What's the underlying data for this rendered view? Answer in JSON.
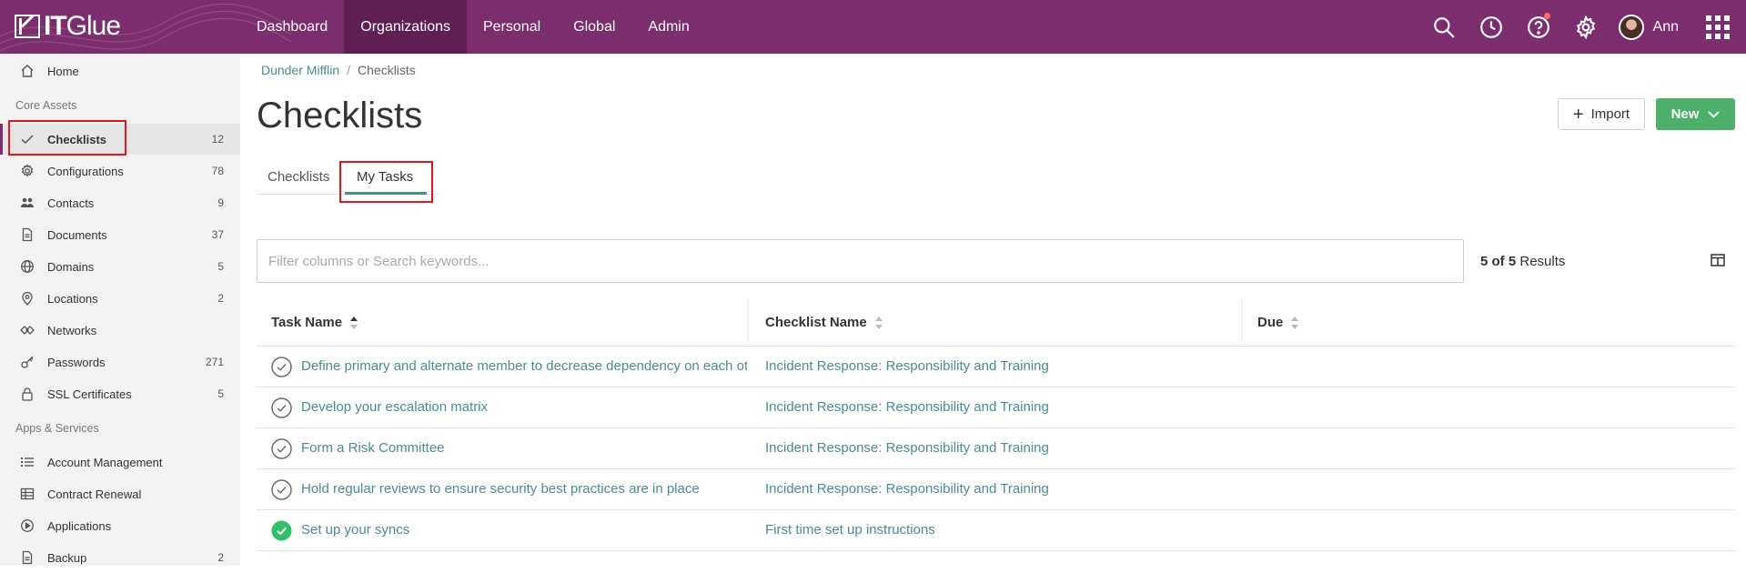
{
  "app": {
    "logo_text_bold": "IT",
    "logo_text_regular": "Glue",
    "brand_color": "#7c2d6e",
    "accent_color": "#4b8b94",
    "success_color": "#4caf6a"
  },
  "topnav": {
    "items": [
      {
        "label": "Dashboard"
      },
      {
        "label": "Organizations",
        "active": true
      },
      {
        "label": "Personal"
      },
      {
        "label": "Global"
      },
      {
        "label": "Admin"
      }
    ],
    "user_name": "Ann",
    "icons": [
      "search-icon",
      "clock-icon",
      "help-icon",
      "gear-icon",
      "apps-grid-icon"
    ]
  },
  "sidebar": {
    "home": {
      "label": "Home",
      "icon": "home-icon"
    },
    "core_assets_title": "Core Assets",
    "core_assets": [
      {
        "label": "Checklists",
        "count": "12",
        "icon": "check-icon",
        "active": true
      },
      {
        "label": "Configurations",
        "count": "78",
        "icon": "gear-icon"
      },
      {
        "label": "Contacts",
        "count": "9",
        "icon": "people-icon"
      },
      {
        "label": "Documents",
        "count": "37",
        "icon": "document-icon"
      },
      {
        "label": "Domains",
        "count": "5",
        "icon": "globe-icon"
      },
      {
        "label": "Locations",
        "count": "2",
        "icon": "map-pin-icon"
      },
      {
        "label": "Networks",
        "count": "",
        "icon": "network-icon"
      },
      {
        "label": "Passwords",
        "count": "271",
        "icon": "key-icon"
      },
      {
        "label": "SSL Certificates",
        "count": "5",
        "icon": "lock-icon"
      }
    ],
    "apps_services_title": "Apps & Services",
    "apps_services": [
      {
        "label": "Account Management",
        "count": "",
        "icon": "list-icon"
      },
      {
        "label": "Contract Renewal",
        "count": "",
        "icon": "table-icon"
      },
      {
        "label": "Applications",
        "count": "",
        "icon": "play-circle-icon"
      },
      {
        "label": "Backup",
        "count": "2",
        "icon": "document-icon"
      }
    ]
  },
  "breadcrumb": {
    "org": "Dunder Mifflin",
    "current": "Checklists"
  },
  "page": {
    "title": "Checklists",
    "import_label": "Import",
    "new_label": "New",
    "tabs": [
      {
        "label": "Checklists"
      },
      {
        "label": "My Tasks",
        "active": true
      }
    ]
  },
  "search": {
    "placeholder": "Filter columns or Search keywords...",
    "value": ""
  },
  "results": {
    "shown": "5 of 5",
    "suffix": " Results"
  },
  "table": {
    "columns": [
      "Task Name",
      "Checklist Name",
      "Due"
    ],
    "rows": [
      {
        "task": "Define primary and alternate member to decrease dependency on each other",
        "checklist": "Incident Response: Responsibility and Training",
        "due": "",
        "done": false
      },
      {
        "task": "Develop your escalation matrix",
        "checklist": "Incident Response: Responsibility and Training",
        "due": "",
        "done": false
      },
      {
        "task": "Form a Risk Committee",
        "checklist": "Incident Response: Responsibility and Training",
        "due": "",
        "done": false
      },
      {
        "task": "Hold regular reviews to ensure security best practices are in place",
        "checklist": "Incident Response: Responsibility and Training",
        "due": "",
        "done": false
      },
      {
        "task": "Set up your syncs",
        "checklist": "First time set up instructions",
        "due": "",
        "done": true
      }
    ]
  }
}
